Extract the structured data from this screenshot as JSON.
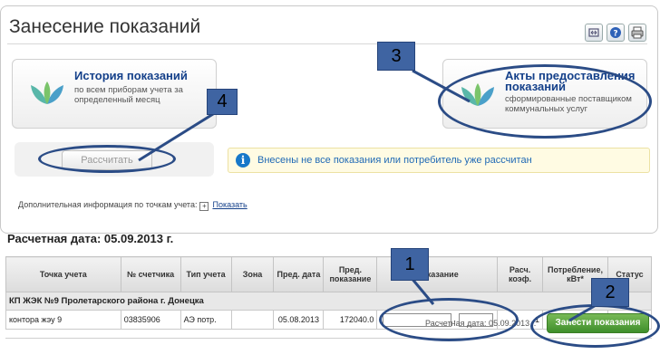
{
  "page": {
    "title": "Занесение показаний"
  },
  "cards": {
    "history": {
      "title": "История показаний",
      "subtitle_line1": "по всем приборам учета за",
      "subtitle_line2": "определенный месяц"
    },
    "acts": {
      "title_line1": "Акты предоставления",
      "title_line2": "показаний",
      "subtitle_line1": "сформированные поставщиком",
      "subtitle_line2": "коммунальных услуг"
    }
  },
  "calculate_button": "Рассчитать",
  "warning": {
    "icon": "i",
    "text": "Внесены не все показания или потребитель уже рассчитан"
  },
  "additional_info": {
    "label": "Дополнительная информация по точкам учета:",
    "plus": "+",
    "link": "Показать"
  },
  "calc_date_title": "Расчетная дата: 05.09.2013 г.",
  "table": {
    "headers": {
      "point": "Точка учета",
      "meter": "№ счетчика",
      "type": "Тип учета",
      "zone": "Зона",
      "prev_date": "Пред. дата",
      "prev_reading_line1": "Пред.",
      "prev_reading_line2": "показание",
      "reading": "Показание",
      "coef_line1": "Расч.",
      "coef_line2": "коэф.",
      "consumption_line1": "Потребление,",
      "consumption_line2": "кВт*",
      "status": "Статус"
    },
    "group": "КП ЖЭК №9 Пролетарского района г. Донецка",
    "rows": [
      {
        "point": "контора жэу 9",
        "meter": "03835906",
        "type": "АЭ потр.",
        "zone": "",
        "prev_date": "05.08.2013",
        "prev_reading": "172040.0",
        "reading_separator": ".",
        "coef": "1",
        "consumption": "",
        "status": ""
      }
    ]
  },
  "footer": {
    "calc_date": "Расчетная дата: 05.09.2013 г.",
    "save_button": "Занести показания"
  },
  "callouts": {
    "c1": "1",
    "c2": "2",
    "c3": "3",
    "c4": "4"
  },
  "colors": {
    "callout_fill": "#3f64a2",
    "ring": "#2b4c86",
    "save_button": "#4c9a36",
    "info_icon": "#1778c9"
  },
  "icons": {
    "tool1": "expand-icon",
    "tool2": "help-icon",
    "tool3": "print-icon",
    "card_logo": "leaf-logo-icon"
  }
}
